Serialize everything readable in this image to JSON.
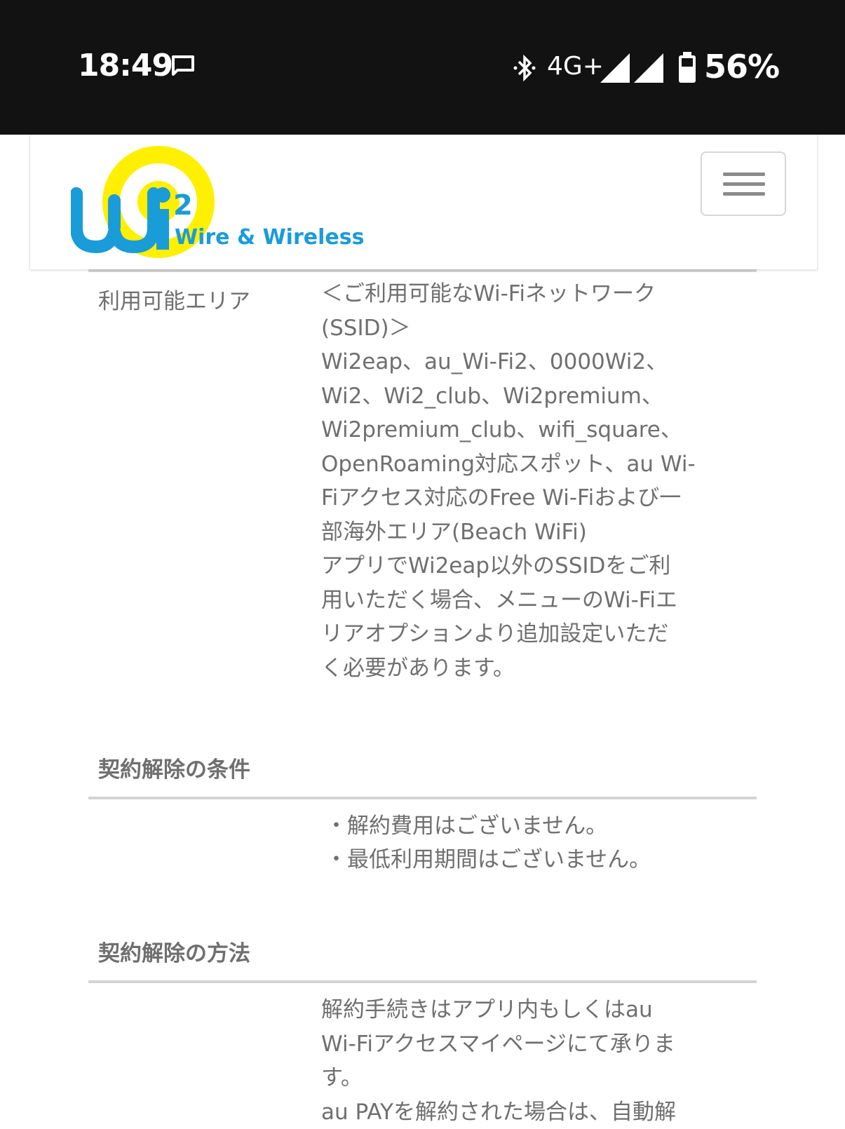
{
  "status_bar": {
    "time": "18:49",
    "network": "4G+",
    "battery": "56%"
  },
  "header": {
    "logo_text": "Wire & Wireless",
    "logo_mark": "Wi2"
  },
  "available_area": {
    "label": "利用可能エリア",
    "lines": [
      "＜ご利用可能なWi-Fiネットワーク",
      "(SSID)＞",
      "Wi2eap、au_Wi-Fi2、0000Wi2、",
      "Wi2、Wi2_club、Wi2premium、",
      "Wi2premium_club、wifi_square、",
      "OpenRoaming対応スポット、au Wi-",
      "Fiアクセス対応のFree Wi-Fiおよび一",
      "部海外エリア(Beach WiFi)",
      "アプリでWi2eap以外のSSIDをご利",
      "用いただく場合、メニューのWi-Fiエ",
      "リアオプションより追加設定いただ",
      "く必要があります。"
    ]
  },
  "cancel_conditions": {
    "heading": "契約解除の条件",
    "items": [
      "解約費用はございません。",
      "最低利用期間はございません。"
    ]
  },
  "cancel_method": {
    "heading": "契約解除の方法",
    "lines": [
      "解約手続きはアプリ内もしくはau",
      "Wi-Fiアクセスマイページにて承りま",
      "す。",
      "au PAYを解約された場合は、自動解"
    ]
  }
}
